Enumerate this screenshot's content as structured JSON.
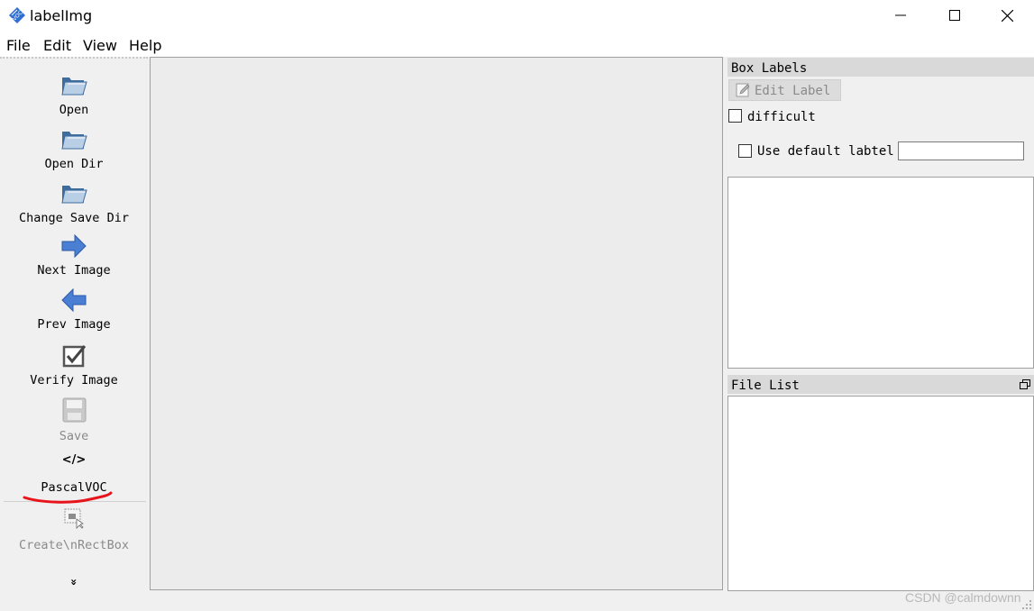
{
  "window": {
    "title": "labelImg",
    "app_icon": "voc-tag-icon",
    "controls": [
      "minimize-icon",
      "maximize-icon",
      "close-icon"
    ]
  },
  "menu": {
    "file": "File",
    "edit": "Edit",
    "view": "View",
    "help": "Help"
  },
  "toolbar": {
    "open": "Open",
    "open_dir": "Open Dir",
    "change_save_dir": "Change Save Dir",
    "next_image": "Next Image",
    "prev_image": "Prev Image",
    "verify_image": "Verify Image",
    "save": "Save",
    "format_icon": "</>",
    "format": "PascalVOC",
    "create_rect_box": "Create\\nRectBox",
    "more": "»"
  },
  "box_labels": {
    "title": "Box Labels",
    "edit_label": "Edit Label",
    "difficult": "difficult",
    "use_default_label": "Use default labtel",
    "default_label_value": ""
  },
  "file_list": {
    "title": "File List"
  },
  "watermark": "CSDN @calmdownn",
  "colors": {
    "annotation_red": "#e8141c",
    "arrow_blue": "#4a7fd4",
    "folder_blue": "#5e86b4"
  }
}
